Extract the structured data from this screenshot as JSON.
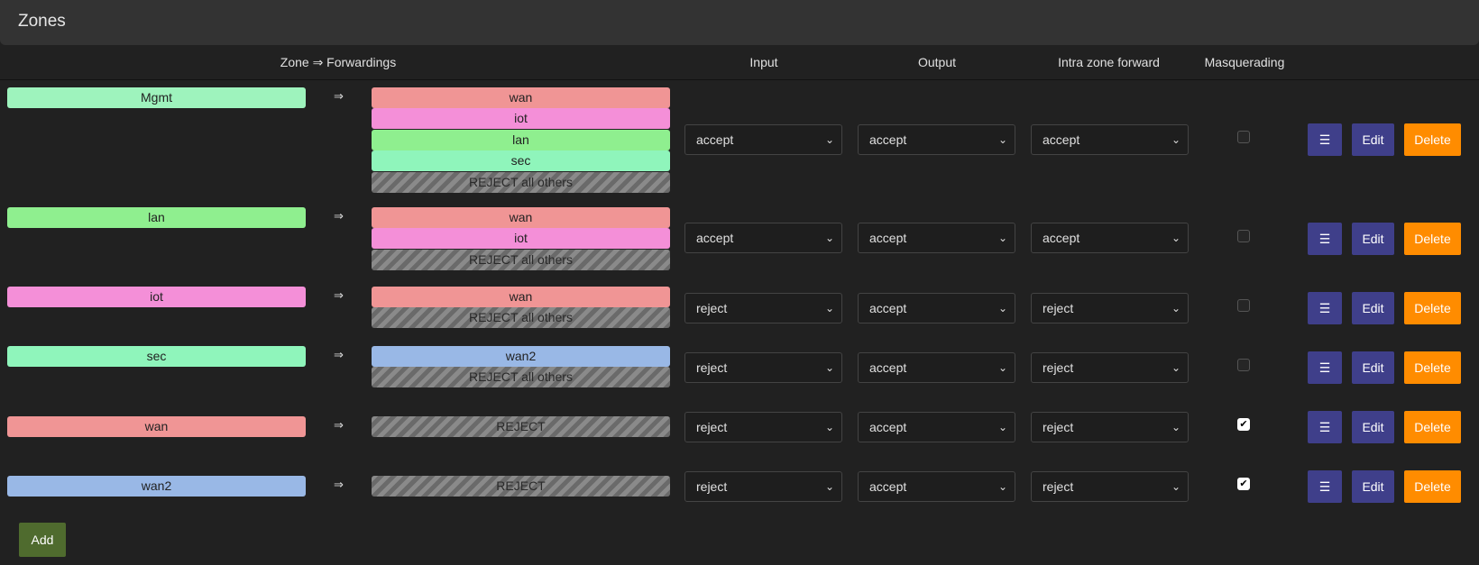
{
  "header": {
    "title": "Zones"
  },
  "columns": {
    "zone_fwd": "Zone ⇒ Forwardings",
    "input": "Input",
    "output": "Output",
    "intra": "Intra zone forward",
    "masq": "Masquerading"
  },
  "arrow": "⇒",
  "colors": {
    "mgmt": "#9ef3bd",
    "lan": "#8fef8f",
    "iot": "#f48fd8",
    "sec": "#8ff5bb",
    "wan": "#f09595",
    "wan2": "#99b8e6",
    "menu_button": "#3f3f8a",
    "delete_button": "#ff8c00",
    "add_button": "#4f6b2e"
  },
  "rows": [
    {
      "zone": "Mgmt",
      "forwards": [
        "wan",
        "iot",
        "lan",
        "sec",
        "REJECT all others"
      ],
      "input": "accept",
      "output": "accept",
      "intra": "accept",
      "masq": false
    },
    {
      "zone": "lan",
      "forwards": [
        "wan",
        "iot",
        "REJECT all others"
      ],
      "input": "accept",
      "output": "accept",
      "intra": "accept",
      "masq": false
    },
    {
      "zone": "iot",
      "forwards": [
        "wan",
        "REJECT all others"
      ],
      "input": "reject",
      "output": "accept",
      "intra": "reject",
      "masq": false
    },
    {
      "zone": "sec",
      "forwards": [
        "wan2",
        "REJECT all others"
      ],
      "input": "reject",
      "output": "accept",
      "intra": "reject",
      "masq": false
    },
    {
      "zone": "wan",
      "forwards": [
        "REJECT"
      ],
      "input": "reject",
      "output": "accept",
      "intra": "reject",
      "masq": true
    },
    {
      "zone": "wan2",
      "forwards": [
        "REJECT"
      ],
      "input": "reject",
      "output": "accept",
      "intra": "reject",
      "masq": true
    }
  ],
  "actions": {
    "menu": "☰",
    "edit": "Edit",
    "delete": "Delete",
    "checkmark": "✔"
  },
  "add_label": "Add"
}
